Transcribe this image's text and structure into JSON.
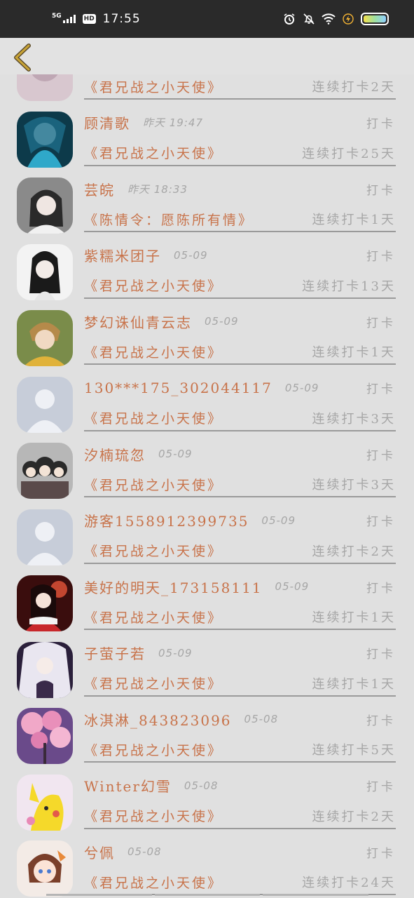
{
  "status_bar": {
    "network": "5G",
    "hd": "HD",
    "time": "17:55"
  },
  "nav": {
    "back_icon": "chevron-left-icon"
  },
  "rows": [
    {
      "name": "",
      "time": "",
      "action": "",
      "book": "《君兄战之小天使》",
      "streak": "连续打卡2天",
      "avatar": "partial-avatar"
    },
    {
      "name": "顾清歌",
      "time": "昨天 19:47",
      "action": "打卡",
      "book": "《君兄战之小天使》",
      "streak": "连续打卡25天",
      "avatar": "anime-blue"
    },
    {
      "name": "芸皖",
      "time": "昨天 18:33",
      "action": "打卡",
      "book": "《陈情令：愿陈所有情》",
      "streak": "连续打卡1天",
      "avatar": "photo-girl"
    },
    {
      "name": "紫糯米团子",
      "time": "05-09",
      "action": "打卡",
      "book": "《君兄战之小天使》",
      "streak": "连续打卡13天",
      "avatar": "sketch-girl"
    },
    {
      "name": "梦幻诛仙青云志",
      "time": "05-09",
      "action": "打卡",
      "book": "《君兄战之小天使》",
      "streak": "连续打卡1天",
      "avatar": "anime-boy"
    },
    {
      "name": "130***175_302044117",
      "time": "05-09",
      "action": "打卡",
      "book": "《君兄战之小天使》",
      "streak": "连续打卡3天",
      "avatar": "default"
    },
    {
      "name": "汐楠琉忽",
      "time": "05-09",
      "action": "打卡",
      "book": "《君兄战之小天使》",
      "streak": "连续打卡3天",
      "avatar": "chibi-group"
    },
    {
      "name": "游客1558912399735",
      "time": "05-09",
      "action": "打卡",
      "book": "《君兄战之小天使》",
      "streak": "连续打卡2天",
      "avatar": "default"
    },
    {
      "name": "美好的明天_173158111",
      "time": "05-09",
      "action": "打卡",
      "book": "《君兄战之小天使》",
      "streak": "连续打卡1天",
      "avatar": "red-girl"
    },
    {
      "name": "子萤子若",
      "time": "05-09",
      "action": "打卡",
      "book": "《君兄战之小天使》",
      "streak": "连续打卡1天",
      "avatar": "white-hair"
    },
    {
      "name": "冰淇淋_843823096",
      "time": "05-08",
      "action": "打卡",
      "book": "《君兄战之小天使》",
      "streak": "连续打卡5天",
      "avatar": "blossom"
    },
    {
      "name": "Winter幻雪",
      "time": "05-08",
      "action": "打卡",
      "book": "《君兄战之小天使》",
      "streak": "连续打卡2天",
      "avatar": "pikachu"
    },
    {
      "name": "兮佩",
      "time": "05-08",
      "action": "打卡",
      "book": "《君兄战之小天使》",
      "streak": "连续打卡24天",
      "avatar": "cute-girl"
    }
  ],
  "colors": {
    "accent": "#c8734a",
    "muted": "#a6a6a6",
    "background": "#e0e0e0"
  }
}
